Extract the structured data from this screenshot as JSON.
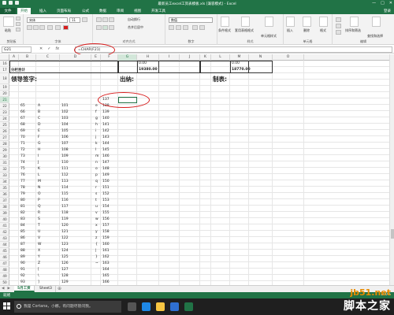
{
  "titlebar": {
    "title": "最新员工excel工资表模板.xls [兼容模式] - Excel",
    "min": "—",
    "max": "□",
    "close": "✕"
  },
  "tabs": [
    "文件",
    "开始",
    "插入",
    "页面布局",
    "公式",
    "数据",
    "审阅",
    "视图",
    "开发工具"
  ],
  "user": "登录",
  "ribbon": {
    "paste_label": "粘贴",
    "clipboard_label": "剪贴板",
    "font_name": "宋体",
    "font_size": "11",
    "font_label": "字体",
    "align_label": "对齐方式",
    "wrap_label": "自动换行",
    "merge_label": "合并后居中",
    "number_format": "数值",
    "number_label": "数字",
    "cond_format": "条件格式",
    "table_format": "套用表格格式",
    "cell_styles": "单元格样式",
    "styles_label": "样式",
    "insert_label": "插入",
    "delete_label": "删除",
    "format_label": "格式",
    "cells_label": "单元格",
    "sort_filter": "排序和筛选",
    "find_select": "查找和选择",
    "edit_label": "编辑"
  },
  "formula_bar": {
    "name_box": "G21",
    "cancel": "✕",
    "enter": "✓",
    "fx": "fx",
    "formula": "=CHAR(F21)"
  },
  "columns": [
    "A",
    "B",
    "C",
    "D",
    "E",
    "F",
    "G",
    "H",
    "I",
    "J",
    "K",
    "L",
    "M",
    "N",
    "O"
  ],
  "selected_column": "G",
  "rows": [
    {
      "num": "16",
      "cells": [
        {
          "col": "H",
          "text": "0.00"
        },
        {
          "col": "M",
          "text": "0.00"
        }
      ]
    },
    {
      "num": "17",
      "cells": [
        {
          "col": "A",
          "text": "分栏合计"
        },
        {
          "col": "H",
          "text": "19380.00"
        },
        {
          "col": "M",
          "text": "18770.00"
        }
      ]
    },
    {
      "num": "18",
      "cells": [
        {
          "col": "A",
          "text": "领导签字:"
        },
        {
          "col": "G",
          "text": "出纳:"
        },
        {
          "col": "L",
          "text": "制表:"
        }
      ]
    },
    {
      "num": "19",
      "cells": []
    },
    {
      "num": "20",
      "cells": []
    },
    {
      "num": "21",
      "cells": [
        {
          "col": "F",
          "text": "137"
        }
      ]
    },
    {
      "num": "22",
      "cells": [
        {
          "col": "B",
          "text": "65"
        },
        {
          "col": "C",
          "text": "A"
        },
        {
          "col": "D",
          "text": "101"
        },
        {
          "col": "E",
          "text": "e"
        },
        {
          "col": "F",
          "text": "138"
        }
      ]
    },
    {
      "num": "23",
      "cells": [
        {
          "col": "B",
          "text": "66"
        },
        {
          "col": "C",
          "text": "B"
        },
        {
          "col": "D",
          "text": "102"
        },
        {
          "col": "E",
          "text": "f"
        },
        {
          "col": "F",
          "text": "139"
        }
      ]
    },
    {
      "num": "24",
      "cells": [
        {
          "col": "B",
          "text": "67"
        },
        {
          "col": "C",
          "text": "C"
        },
        {
          "col": "D",
          "text": "103"
        },
        {
          "col": "E",
          "text": "g"
        },
        {
          "col": "F",
          "text": "140"
        }
      ]
    },
    {
      "num": "25",
      "cells": [
        {
          "col": "B",
          "text": "68"
        },
        {
          "col": "C",
          "text": "D"
        },
        {
          "col": "D",
          "text": "104"
        },
        {
          "col": "E",
          "text": "h"
        },
        {
          "col": "F",
          "text": "141"
        }
      ]
    },
    {
      "num": "26",
      "cells": [
        {
          "col": "B",
          "text": "69"
        },
        {
          "col": "C",
          "text": "E"
        },
        {
          "col": "D",
          "text": "105"
        },
        {
          "col": "E",
          "text": "i"
        },
        {
          "col": "F",
          "text": "142"
        }
      ]
    },
    {
      "num": "27",
      "cells": [
        {
          "col": "B",
          "text": "70"
        },
        {
          "col": "C",
          "text": "F"
        },
        {
          "col": "D",
          "text": "106"
        },
        {
          "col": "E",
          "text": "j"
        },
        {
          "col": "F",
          "text": "143"
        }
      ]
    },
    {
      "num": "28",
      "cells": [
        {
          "col": "B",
          "text": "71"
        },
        {
          "col": "C",
          "text": "G"
        },
        {
          "col": "D",
          "text": "107"
        },
        {
          "col": "E",
          "text": "k"
        },
        {
          "col": "F",
          "text": "144"
        }
      ]
    },
    {
      "num": "29",
      "cells": [
        {
          "col": "B",
          "text": "72"
        },
        {
          "col": "C",
          "text": "H"
        },
        {
          "col": "D",
          "text": "108"
        },
        {
          "col": "E",
          "text": "l"
        },
        {
          "col": "F",
          "text": "145"
        }
      ]
    },
    {
      "num": "30",
      "cells": [
        {
          "col": "B",
          "text": "73"
        },
        {
          "col": "C",
          "text": "I"
        },
        {
          "col": "D",
          "text": "109"
        },
        {
          "col": "E",
          "text": "m"
        },
        {
          "col": "F",
          "text": "146"
        }
      ]
    },
    {
      "num": "31",
      "cells": [
        {
          "col": "B",
          "text": "74"
        },
        {
          "col": "C",
          "text": "J"
        },
        {
          "col": "D",
          "text": "110"
        },
        {
          "col": "E",
          "text": "n"
        },
        {
          "col": "F",
          "text": "147"
        }
      ]
    },
    {
      "num": "32",
      "cells": [
        {
          "col": "B",
          "text": "75"
        },
        {
          "col": "C",
          "text": "K"
        },
        {
          "col": "D",
          "text": "111"
        },
        {
          "col": "E",
          "text": "o"
        },
        {
          "col": "F",
          "text": "148"
        }
      ]
    },
    {
      "num": "33",
      "cells": [
        {
          "col": "B",
          "text": "76"
        },
        {
          "col": "C",
          "text": "L"
        },
        {
          "col": "D",
          "text": "112"
        },
        {
          "col": "E",
          "text": "p"
        },
        {
          "col": "F",
          "text": "149"
        }
      ]
    },
    {
      "num": "34",
      "cells": [
        {
          "col": "B",
          "text": "77"
        },
        {
          "col": "C",
          "text": "M"
        },
        {
          "col": "D",
          "text": "113"
        },
        {
          "col": "E",
          "text": "q"
        },
        {
          "col": "F",
          "text": "150"
        }
      ]
    },
    {
      "num": "35",
      "cells": [
        {
          "col": "B",
          "text": "78"
        },
        {
          "col": "C",
          "text": "N"
        },
        {
          "col": "D",
          "text": "114"
        },
        {
          "col": "E",
          "text": "r"
        },
        {
          "col": "F",
          "text": "151"
        }
      ]
    },
    {
      "num": "36",
      "cells": [
        {
          "col": "B",
          "text": "79"
        },
        {
          "col": "C",
          "text": "O"
        },
        {
          "col": "D",
          "text": "115"
        },
        {
          "col": "E",
          "text": "s"
        },
        {
          "col": "F",
          "text": "152"
        }
      ]
    },
    {
      "num": "37",
      "cells": [
        {
          "col": "B",
          "text": "80"
        },
        {
          "col": "C",
          "text": "P"
        },
        {
          "col": "D",
          "text": "116"
        },
        {
          "col": "E",
          "text": "t"
        },
        {
          "col": "F",
          "text": "153"
        }
      ]
    },
    {
      "num": "38",
      "cells": [
        {
          "col": "B",
          "text": "81"
        },
        {
          "col": "C",
          "text": "Q"
        },
        {
          "col": "D",
          "text": "117"
        },
        {
          "col": "E",
          "text": "u"
        },
        {
          "col": "F",
          "text": "154"
        }
      ]
    },
    {
      "num": "39",
      "cells": [
        {
          "col": "B",
          "text": "82"
        },
        {
          "col": "C",
          "text": "R"
        },
        {
          "col": "D",
          "text": "118"
        },
        {
          "col": "E",
          "text": "v"
        },
        {
          "col": "F",
          "text": "155"
        }
      ]
    },
    {
      "num": "40",
      "cells": [
        {
          "col": "B",
          "text": "83"
        },
        {
          "col": "C",
          "text": "S"
        },
        {
          "col": "D",
          "text": "119"
        },
        {
          "col": "E",
          "text": "w"
        },
        {
          "col": "F",
          "text": "156"
        }
      ]
    },
    {
      "num": "41",
      "cells": [
        {
          "col": "B",
          "text": "84"
        },
        {
          "col": "C",
          "text": "T"
        },
        {
          "col": "D",
          "text": "120"
        },
        {
          "col": "E",
          "text": "x"
        },
        {
          "col": "F",
          "text": "157"
        }
      ]
    },
    {
      "num": "42",
      "cells": [
        {
          "col": "B",
          "text": "85"
        },
        {
          "col": "C",
          "text": "U"
        },
        {
          "col": "D",
          "text": "121"
        },
        {
          "col": "E",
          "text": "y"
        },
        {
          "col": "F",
          "text": "158"
        }
      ]
    },
    {
      "num": "43",
      "cells": [
        {
          "col": "B",
          "text": "86"
        },
        {
          "col": "C",
          "text": "V"
        },
        {
          "col": "D",
          "text": "122"
        },
        {
          "col": "E",
          "text": "z"
        },
        {
          "col": "F",
          "text": "159"
        }
      ]
    },
    {
      "num": "44",
      "cells": [
        {
          "col": "B",
          "text": "87"
        },
        {
          "col": "C",
          "text": "W"
        },
        {
          "col": "D",
          "text": "123"
        },
        {
          "col": "E",
          "text": "{"
        },
        {
          "col": "F",
          "text": "160"
        }
      ]
    },
    {
      "num": "45",
      "cells": [
        {
          "col": "B",
          "text": "88"
        },
        {
          "col": "C",
          "text": "X"
        },
        {
          "col": "D",
          "text": "124"
        },
        {
          "col": "E",
          "text": "|"
        },
        {
          "col": "F",
          "text": "161"
        }
      ]
    },
    {
      "num": "46",
      "cells": [
        {
          "col": "B",
          "text": "89"
        },
        {
          "col": "C",
          "text": "Y"
        },
        {
          "col": "D",
          "text": "125"
        },
        {
          "col": "E",
          "text": "}"
        },
        {
          "col": "F",
          "text": "162"
        }
      ]
    },
    {
      "num": "47",
      "cells": [
        {
          "col": "B",
          "text": "90"
        },
        {
          "col": "C",
          "text": "Z"
        },
        {
          "col": "D",
          "text": "126"
        },
        {
          "col": "E",
          "text": "~"
        },
        {
          "col": "F",
          "text": "163"
        }
      ]
    },
    {
      "num": "48",
      "cells": [
        {
          "col": "B",
          "text": "91"
        },
        {
          "col": "C",
          "text": "["
        },
        {
          "col": "D",
          "text": "127"
        },
        {
          "col": "F",
          "text": "164"
        }
      ]
    },
    {
      "num": "49",
      "cells": [
        {
          "col": "B",
          "text": "92"
        },
        {
          "col": "C",
          "text": "\\"
        },
        {
          "col": "D",
          "text": "128"
        },
        {
          "col": "F",
          "text": "165"
        }
      ]
    },
    {
      "num": "50",
      "cells": [
        {
          "col": "B",
          "text": "93"
        },
        {
          "col": "C",
          "text": "]"
        },
        {
          "col": "D",
          "text": "129"
        },
        {
          "col": "F",
          "text": "166"
        }
      ]
    },
    {
      "num": "51",
      "cells": [
        {
          "col": "B",
          "text": "94"
        },
        {
          "col": "C",
          "text": "^"
        },
        {
          "col": "D",
          "text": "130"
        },
        {
          "col": "F",
          "text": "167"
        }
      ]
    }
  ],
  "sheet_tabs": [
    "5月工资",
    "Sheet3"
  ],
  "active_sheet": "5月工资",
  "add_sheet": "⊕",
  "status": {
    "ready": "就绪",
    "zoom": "100%"
  },
  "taskbar": {
    "search_placeholder": "我是 Cortana，小娜。有问题尽管问我。"
  },
  "watermark": {
    "site": "jb51.net",
    "brand": "脚本之家"
  },
  "colors": {
    "excel_green": "#217346",
    "annotation_red": "#d81e1e",
    "watermark_orange": "#e98b00"
  }
}
